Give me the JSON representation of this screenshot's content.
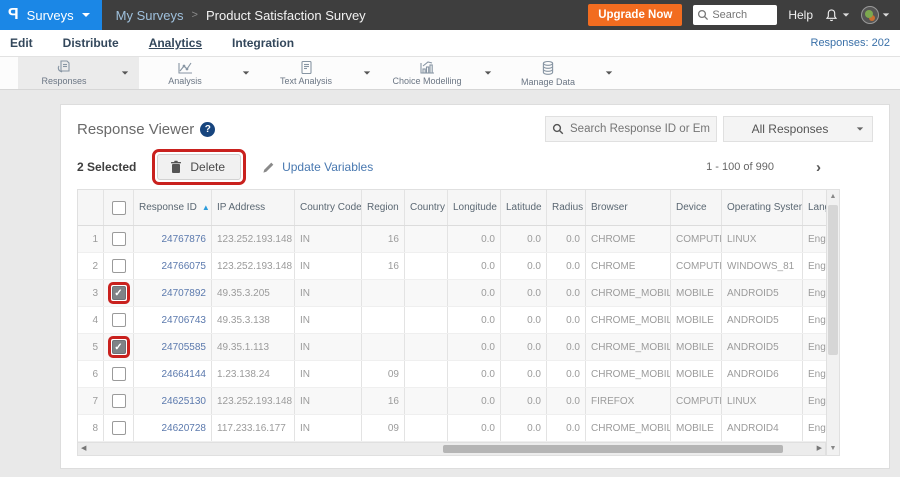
{
  "topbar": {
    "product_menu": "Surveys",
    "breadcrumb_parent": "My Surveys",
    "breadcrumb_sep": ">",
    "breadcrumb_current": "Product Satisfaction Survey",
    "upgrade_button": "Upgrade Now",
    "search_placeholder": "Search",
    "help_label": "Help"
  },
  "nav": {
    "items": [
      {
        "label": "Edit"
      },
      {
        "label": "Distribute"
      },
      {
        "label": "Analytics",
        "active": true
      },
      {
        "label": "Integration"
      }
    ],
    "responses_badge": "Responses: 202"
  },
  "toolbar": {
    "items": [
      {
        "label": "Responses",
        "icon": "responses-icon",
        "selected": true
      },
      {
        "label": "Analysis",
        "icon": "analysis-icon",
        "selected": false
      },
      {
        "label": "Text Analysis",
        "icon": "text-analysis-icon",
        "selected": false
      },
      {
        "label": "Choice Modelling",
        "icon": "choice-modelling-icon",
        "selected": false
      },
      {
        "label": "Manage Data",
        "icon": "manage-data-icon",
        "selected": false
      }
    ]
  },
  "viewer": {
    "title": "Response Viewer",
    "help_icon": "?",
    "search_placeholder": "Search Response ID or Email",
    "filter_selected": "All Responses",
    "selected_count": "2 Selected",
    "delete_button": "Delete",
    "update_variables_button": "Update Variables",
    "pagination": "1 - 100 of 990",
    "pager_next_icon": "›"
  },
  "table": {
    "sorted_column": "Response ID",
    "sort_direction": "asc",
    "sort_icon": "▲",
    "columns": [
      "",
      "",
      "Response ID",
      "IP Address",
      "Country Code",
      "Region",
      "Country",
      "Longitude",
      "Latitude",
      "Radius",
      "Browser",
      "Device",
      "Operating System",
      "Language"
    ],
    "rows": [
      {
        "num": "1",
        "id": "24767876",
        "ip": "123.252.193.148",
        "country_code": "IN",
        "region": "16",
        "country": "",
        "longitude": "0.0",
        "latitude": "0.0",
        "radius": "0.0",
        "browser": "CHROME",
        "device": "COMPUTER",
        "os": "LINUX",
        "language": "English",
        "checked": false,
        "annotated": false
      },
      {
        "num": "2",
        "id": "24766075",
        "ip": "123.252.193.148",
        "country_code": "IN",
        "region": "16",
        "country": "",
        "longitude": "0.0",
        "latitude": "0.0",
        "radius": "0.0",
        "browser": "CHROME",
        "device": "COMPUTER",
        "os": "WINDOWS_81",
        "language": "English",
        "checked": false,
        "annotated": false
      },
      {
        "num": "3",
        "id": "24707892",
        "ip": "49.35.3.205",
        "country_code": "IN",
        "region": "",
        "country": "",
        "longitude": "0.0",
        "latitude": "0.0",
        "radius": "0.0",
        "browser": "CHROME_MOBILE",
        "device": "MOBILE",
        "os": "ANDROID5",
        "language": "English",
        "checked": true,
        "annotated": true
      },
      {
        "num": "4",
        "id": "24706743",
        "ip": "49.35.3.138",
        "country_code": "IN",
        "region": "",
        "country": "",
        "longitude": "0.0",
        "latitude": "0.0",
        "radius": "0.0",
        "browser": "CHROME_MOBILE",
        "device": "MOBILE",
        "os": "ANDROID5",
        "language": "English",
        "checked": false,
        "annotated": false
      },
      {
        "num": "5",
        "id": "24705585",
        "ip": "49.35.1.113",
        "country_code": "IN",
        "region": "",
        "country": "",
        "longitude": "0.0",
        "latitude": "0.0",
        "radius": "0.0",
        "browser": "CHROME_MOBILE",
        "device": "MOBILE",
        "os": "ANDROID5",
        "language": "English",
        "checked": true,
        "annotated": true
      },
      {
        "num": "6",
        "id": "24664144",
        "ip": "1.23.138.24",
        "country_code": "IN",
        "region": "09",
        "country": "",
        "longitude": "0.0",
        "latitude": "0.0",
        "radius": "0.0",
        "browser": "CHROME_MOBILE",
        "device": "MOBILE",
        "os": "ANDROID6",
        "language": "English",
        "checked": false,
        "annotated": false
      },
      {
        "num": "7",
        "id": "24625130",
        "ip": "123.252.193.148",
        "country_code": "IN",
        "region": "16",
        "country": "",
        "longitude": "0.0",
        "latitude": "0.0",
        "radius": "0.0",
        "browser": "FIREFOX",
        "device": "COMPUTER",
        "os": "LINUX",
        "language": "English",
        "checked": false,
        "annotated": false
      },
      {
        "num": "8",
        "id": "24620728",
        "ip": "117.233.16.177",
        "country_code": "IN",
        "region": "09",
        "country": "",
        "longitude": "0.0",
        "latitude": "0.0",
        "radius": "0.0",
        "browser": "CHROME_MOBILE",
        "device": "MOBILE",
        "os": "ANDROID4",
        "language": "English",
        "checked": false,
        "annotated": false
      }
    ]
  },
  "colors": {
    "brand_blue": "#1b87e6",
    "topbar_dark": "#3e3e3e",
    "upgrade_orange": "#f26c20",
    "link_blue": "#5b79ad",
    "action_blue": "#4878b0",
    "annotation_red": "#c9211e"
  }
}
